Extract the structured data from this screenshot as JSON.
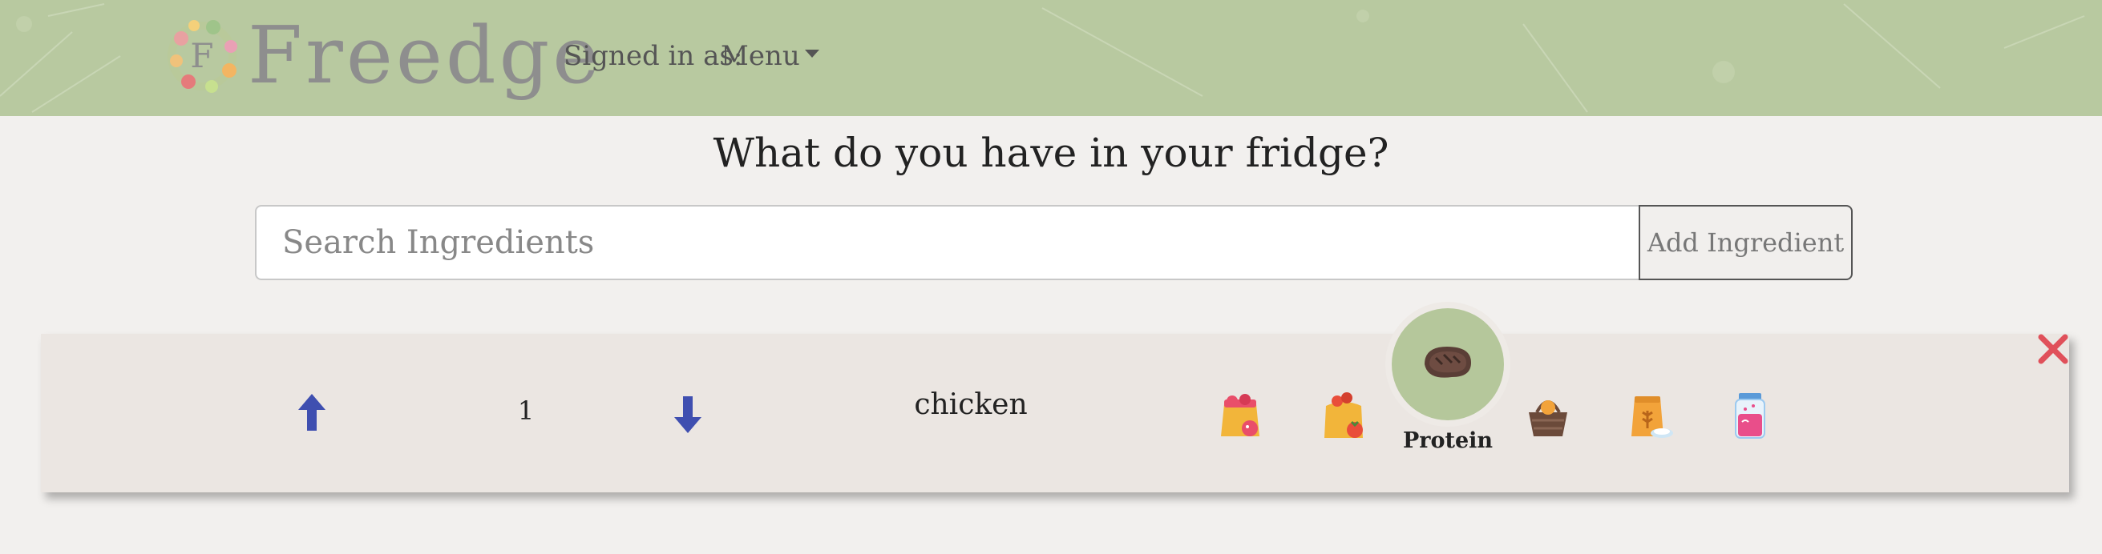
{
  "header": {
    "brand": "Freedge",
    "logo_letter": "F",
    "signed_in_label": "Signed in as:",
    "menu_label": "Menu",
    "background_color": "#b8c9a0"
  },
  "main": {
    "title": "What do you have in your fridge?",
    "search": {
      "placeholder": "Search Ingredients",
      "value": ""
    },
    "add_button_label": "Add Ingredient"
  },
  "ingredients": [
    {
      "name": "chicken",
      "quantity": "1",
      "increase_icon": "arrow-up-icon",
      "decrease_icon": "arrow-down-icon",
      "selected_category": "Protein",
      "categories": [
        {
          "icon": "red-bag-icon",
          "selected": false
        },
        {
          "icon": "tomato-bag-icon",
          "selected": false
        },
        {
          "icon": "steak-icon",
          "label": "Protein",
          "selected": true
        },
        {
          "icon": "basket-icon",
          "selected": false
        },
        {
          "icon": "grain-sack-icon",
          "selected": false
        },
        {
          "icon": "jar-icon",
          "selected": false
        }
      ],
      "remove_icon": "close-icon"
    }
  ],
  "colors": {
    "arrow": "#3f4fb0",
    "selected_circle": "#b5c79b",
    "remove": "#e0505a",
    "row_background": "#ebe6e2"
  }
}
